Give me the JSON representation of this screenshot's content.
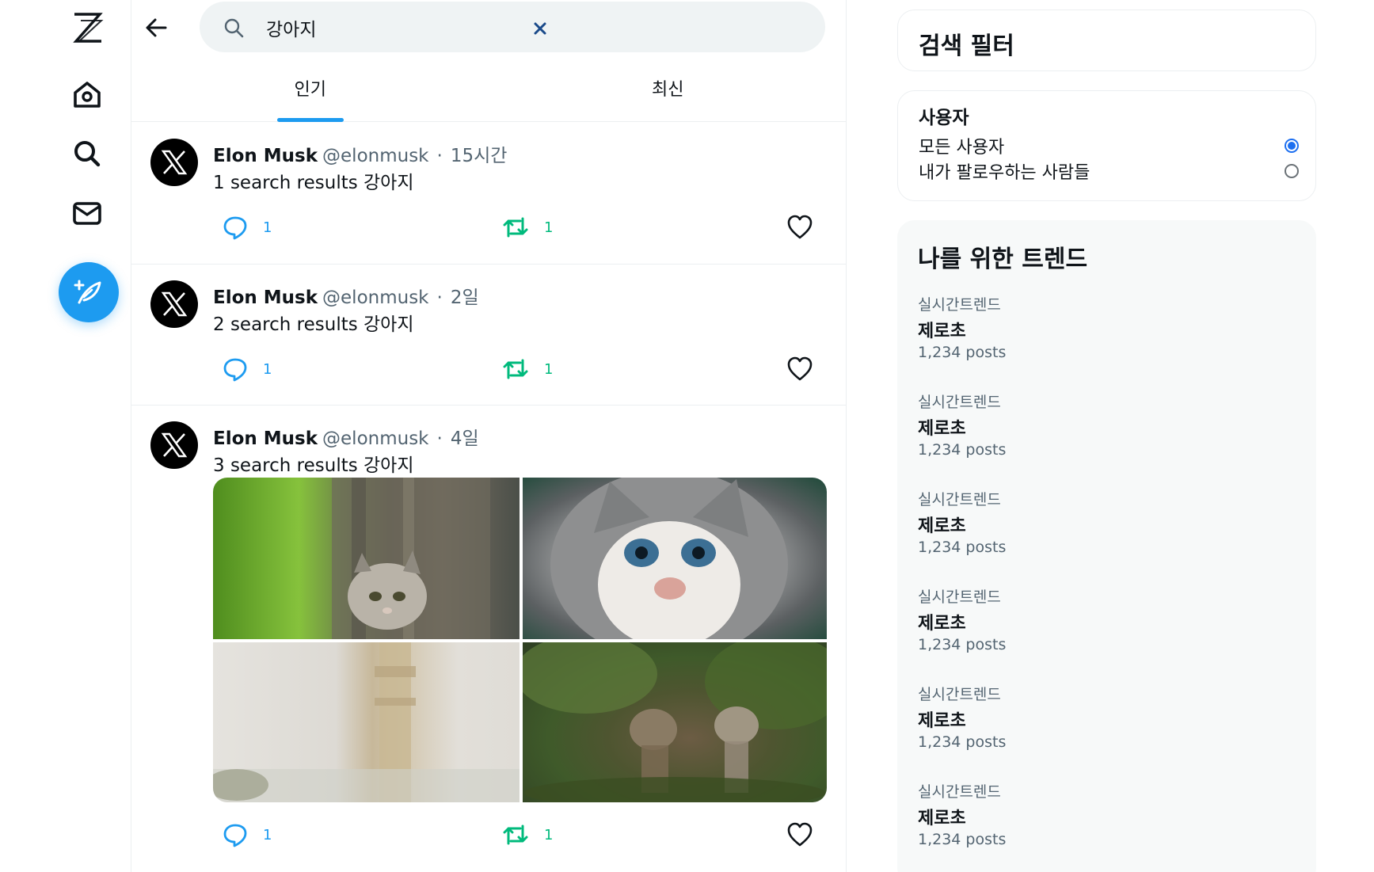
{
  "nav": {
    "logo": "Z",
    "items": [
      {
        "name": "home-icon"
      },
      {
        "name": "search-icon"
      },
      {
        "name": "mail-icon"
      }
    ],
    "compose_icon": "feather-plus-icon",
    "accent": "#1d9bf0"
  },
  "search": {
    "value": "강아지",
    "back_icon": "arrow-left-icon",
    "clear_icon": "close-icon"
  },
  "tabs": [
    {
      "label": "인기",
      "active": true
    },
    {
      "label": "최신",
      "active": false
    }
  ],
  "posts": [
    {
      "name": "Elon Musk",
      "handle": "@elonmusk",
      "separator": "·",
      "time": "15시간",
      "text": "1 search results 강아지",
      "replies": "1",
      "reposts": "1",
      "has_media": false
    },
    {
      "name": "Elon Musk",
      "handle": "@elonmusk",
      "separator": "·",
      "time": "2일",
      "text": "2 search results 강아지",
      "replies": "1",
      "reposts": "1",
      "has_media": false
    },
    {
      "name": "Elon Musk",
      "handle": "@elonmusk",
      "separator": "·",
      "time": "4일",
      "text": "3 search results 강아지",
      "replies": "1",
      "reposts": "1",
      "has_media": true
    }
  ],
  "filters": {
    "title": "검색 필터",
    "users_heading": "사용자",
    "options": [
      {
        "label": "모든 사용자",
        "selected": true
      },
      {
        "label": "내가 팔로우하는 사람들",
        "selected": false
      }
    ]
  },
  "trends": {
    "title": "나를 위한 트렌드",
    "items": [
      {
        "category": "실시간트렌드",
        "title": "제로초",
        "posts": "1,234 posts"
      },
      {
        "category": "실시간트렌드",
        "title": "제로초",
        "posts": "1,234 posts"
      },
      {
        "category": "실시간트렌드",
        "title": "제로초",
        "posts": "1,234 posts"
      },
      {
        "category": "실시간트렌드",
        "title": "제로초",
        "posts": "1,234 posts"
      },
      {
        "category": "실시간트렌드",
        "title": "제로초",
        "posts": "1,234 posts"
      },
      {
        "category": "실시간트렌드",
        "title": "제로초",
        "posts": "1,234 posts"
      }
    ]
  },
  "colors": {
    "reply": "#1d9bf0",
    "repost": "#00ba7c",
    "radio_selected": "#1d6ff0"
  }
}
